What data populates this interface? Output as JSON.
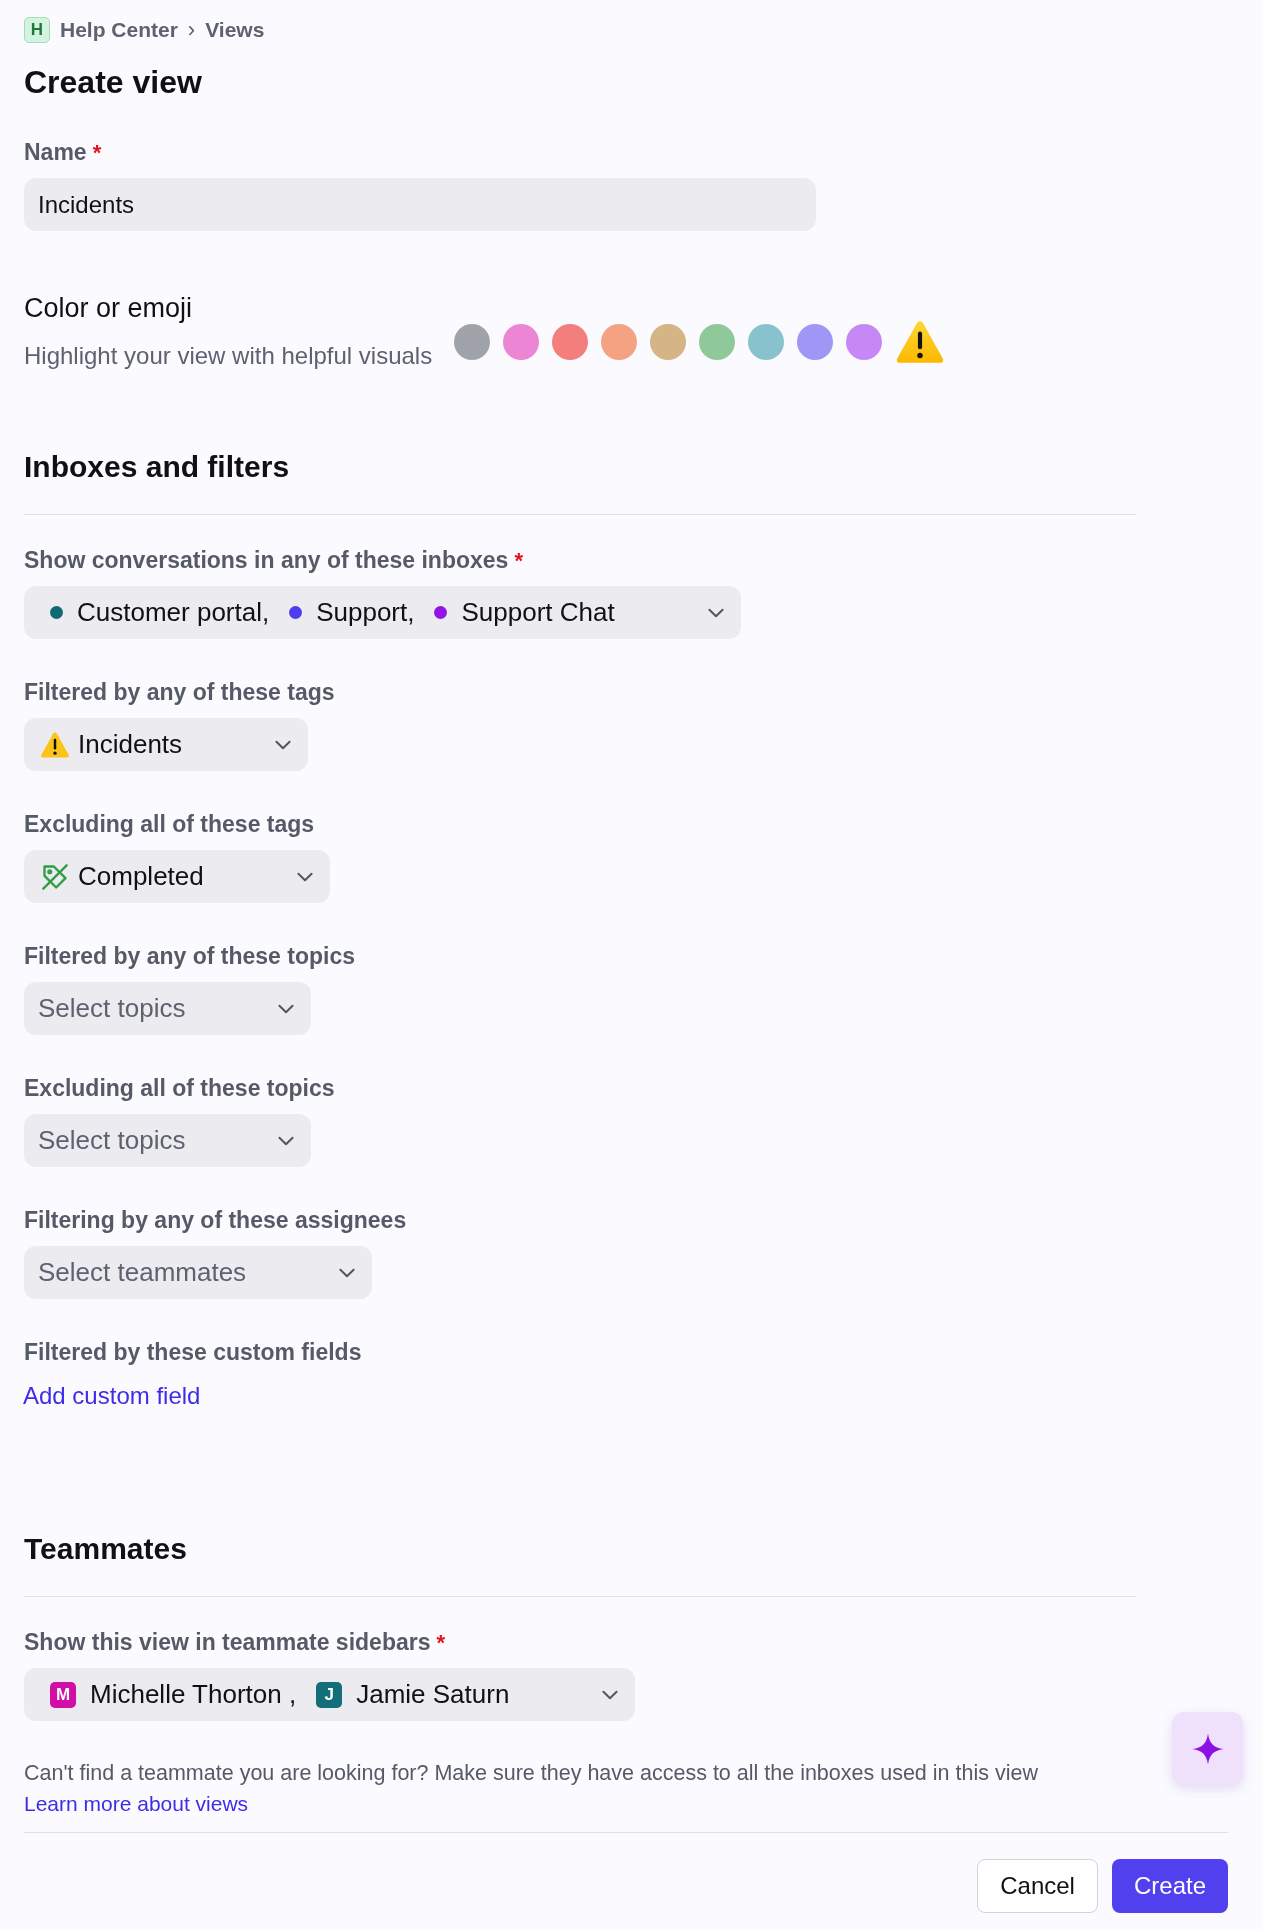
{
  "breadcrumb": {
    "badge": "H",
    "items": [
      "Help Center",
      "Views"
    ],
    "separator": "›"
  },
  "title": "Create view",
  "name_field": {
    "label": "Name",
    "required_mark": "*",
    "value": "Incidents"
  },
  "appearance": {
    "title": "Color or emoji",
    "subtitle": "Highlight your view with helpful visuals",
    "options": [
      {
        "kind": "color",
        "color": "#a1a3aa"
      },
      {
        "kind": "color",
        "color": "#ec85d3"
      },
      {
        "kind": "color",
        "color": "#f37f7c"
      },
      {
        "kind": "color",
        "color": "#f5a283"
      },
      {
        "kind": "color",
        "color": "#d5b486"
      },
      {
        "kind": "color",
        "color": "#90c999"
      },
      {
        "kind": "color",
        "color": "#88c2cd"
      },
      {
        "kind": "color",
        "color": "#9f96f5"
      },
      {
        "kind": "color",
        "color": "#c688f5"
      },
      {
        "kind": "emoji"
      }
    ]
  },
  "sections": [
    {
      "title": "Inboxes and filters",
      "fields": [
        {
          "label": "Show conversations in any of these inboxes",
          "required_mark": "*",
          "kind": "dots",
          "values": [
            {
              "text": "Customer portal,",
              "color": "#0e6b73"
            },
            {
              "text": "Support,",
              "color": "#4f3cf0"
            },
            {
              "text": "Support Chat",
              "color": "#9315e6"
            }
          ]
        },
        {
          "label": "Filtered by any of these tags",
          "kind": "tags",
          "values": [
            {
              "text": "Incidents",
              "kind": "warning"
            }
          ]
        },
        {
          "label": "Excluding all of these tags",
          "kind": "tags",
          "values": [
            {
              "text": "Completed",
              "kind": "tag-slash"
            }
          ]
        },
        {
          "label": "Filtered by any of these topics",
          "kind": "placeholder",
          "placeholder": "Select topics"
        },
        {
          "label": "Excluding all of these topics",
          "kind": "placeholder",
          "placeholder": "Select topics"
        },
        {
          "label": "Filtering by any of these assignees",
          "kind": "placeholder",
          "placeholder": "Select teammates"
        },
        {
          "label": "Filtered by these custom fields",
          "kind": "link",
          "link": "Add custom field"
        }
      ]
    },
    {
      "title": "Teammates",
      "fields": [
        {
          "label": "Show this view in teammate sidebars",
          "required_mark": "*",
          "kind": "avatars",
          "values": [
            {
              "initial": "M",
              "text": "Michelle Thorton ,",
              "color": "#d10fa8"
            },
            {
              "initial": "J",
              "text": "Jamie Saturn",
              "color": "#136e7a"
            }
          ]
        }
      ]
    }
  ],
  "note": {
    "text": "Can't find a teammate you are looking for? Make sure they have access to all the inboxes used in this view",
    "link": "Learn more about views"
  },
  "buttons": {
    "cancel": "Cancel",
    "create": "Create"
  }
}
